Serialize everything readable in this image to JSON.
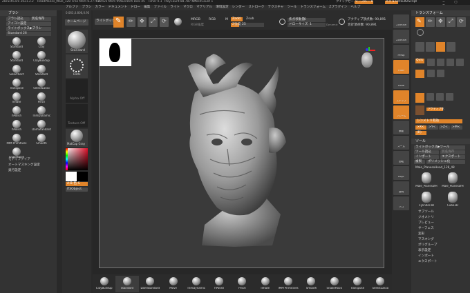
{
  "titlebar": {
    "app": "ZBrushCore 2021.2.2",
    "file": "HeadPlanes_Male_128",
    "freemem": "Free Mem 6.27768",
    "activemem": "Active Mem 999",
    "scratch": "Scratch Disk 45",
    "timer": "Timer 0.1",
    "polycount": "PolyCount 88.787 KP",
    "meshcount": "MeshCount 1",
    "quicksave": "クイックセーブ",
    "see_through": "シースルー 0",
    "menus": "メニュー",
    "script": "DefaultZScript"
  },
  "menubar": {
    "items": [
      "アルファ",
      "ブラシ",
      "カラー",
      "ドキュメント",
      "ドロー",
      "編集",
      "ファイル",
      "ライト",
      "マクロ",
      "マテリアル",
      "環境設定",
      "レンダー",
      "ストローク",
      "テクスチャ",
      "ツール",
      "トランスフォーム",
      "Zプラグイン",
      "ヘルプ"
    ],
    "coords": "0.063,0.806,0.93"
  },
  "left_panel": {
    "title": "ブラシ",
    "btn_load": "ブラシ読込",
    "btn_save": "別名保存",
    "btn_icon": "アイコン設定",
    "btn_lightbox": "ライトボックス▶ブラシ",
    "brush_size_label": "Standard",
    "brush_size": "26",
    "brushes": [
      {
        "name": "Standard"
      },
      {
        "name": "Clay"
      },
      {
        "name": "Standard"
      },
      {
        "name": "ClayBuildup"
      },
      {
        "name": "SelectRect"
      },
      {
        "name": "Standard"
      },
      {
        "name": "Transpose"
      },
      {
        "name": "SelectLasso"
      },
      {
        "name": "Inflate"
      },
      {
        "name": "Pinch"
      },
      {
        "name": "hPolish"
      },
      {
        "name": "TrimDynamic"
      },
      {
        "name": "hPolish"
      },
      {
        "name": "DamStandard"
      },
      {
        "name": "IMM Primitives"
      },
      {
        "name": "Smooth"
      },
      {
        "name": "SnakeHook"
      }
    ],
    "modifier": "モディファイア",
    "auto_mask": "オートマスキング設定",
    "depth": "奥行設定"
  },
  "tool_column": {
    "home": "ホームページ",
    "standard": "Standard",
    "dots": "Dots",
    "alpha_off": "Alpha Off",
    "texture_off": "Texture Off",
    "material": "MatCap Gray",
    "color_label": "A-B-色-S",
    "backdrop": "ff3Object"
  },
  "top_toolbar": {
    "lightbox": "ライトボックス",
    "edit": "エディット",
    "draw": "ドロー",
    "move": "移動",
    "scale": "スケール",
    "rotate": "回転",
    "mrgb": "MRGB",
    "rgb": "RGB",
    "m": "M",
    "zadd": "Zadd",
    "zsub": "Zsub",
    "rgb_intensity": "RGB強度",
    "z_intensity_label": "Z強度",
    "z_intensity": "25",
    "focal_shift_label": "焦点移動量",
    "focal_shift": "0",
    "draw_size_label": "ドローサイズ",
    "draw_size": "1",
    "dynamic": "Dynamic",
    "active_points": "アクティブ頂点数: 90,891",
    "total_points": "合計頂点数: 90,891"
  },
  "right_toolbar": {
    "items": [
      "2Zbrush",
      "2Zbrush",
      "Persp",
      "Floor",
      "Local",
      "スナップ",
      "フレーム",
      "移動",
      "ズーム",
      "回転",
      "PolyF",
      "透明",
      "ソロ"
    ]
  },
  "transform_panel": {
    "title": "トランスフォーム",
    "quick": "Qvis",
    "mirror": "シンメトリ有効",
    "x": ">X<",
    "y": ">Y<",
    "z": ">Z<",
    "m": ">M<",
    "r": "(R)",
    "activate": "アクティブ化"
  },
  "tool_panel": {
    "title": "ツール",
    "lightbox": "ライトボックス▶ツール",
    "load": "ツール読込",
    "save": "別名保存",
    "import": "インポート",
    "export": "エクスポート",
    "clone": "複製",
    "polymesh": "ポリメッシュ化",
    "current": "Male_PlanesoHead_128_48",
    "tools": [
      "Male_PlanesofH",
      "Male_PlanesofH",
      "Cylinder3D",
      "Cube3D"
    ],
    "sections": [
      "サブツール",
      "ジオメトリ",
      "プレビュー",
      "サーフェス",
      "変形",
      "マスキング",
      "ポリグループ",
      "表示設定",
      "インポート",
      "エクスポート"
    ]
  },
  "bottom_shelf": {
    "brushes": [
      "ClayBuildup",
      "Standard",
      "DamStandard",
      "Move",
      "TrimDynamic",
      "hPolish",
      "Pinch",
      "Inflate",
      "IMM Primitives",
      "Smooth",
      "SnakeHook",
      "Transpose",
      "SelectLasso"
    ]
  },
  "colors": {
    "accent": "#e0842a",
    "bg": "#292929",
    "panel": "#3a3a3a"
  }
}
